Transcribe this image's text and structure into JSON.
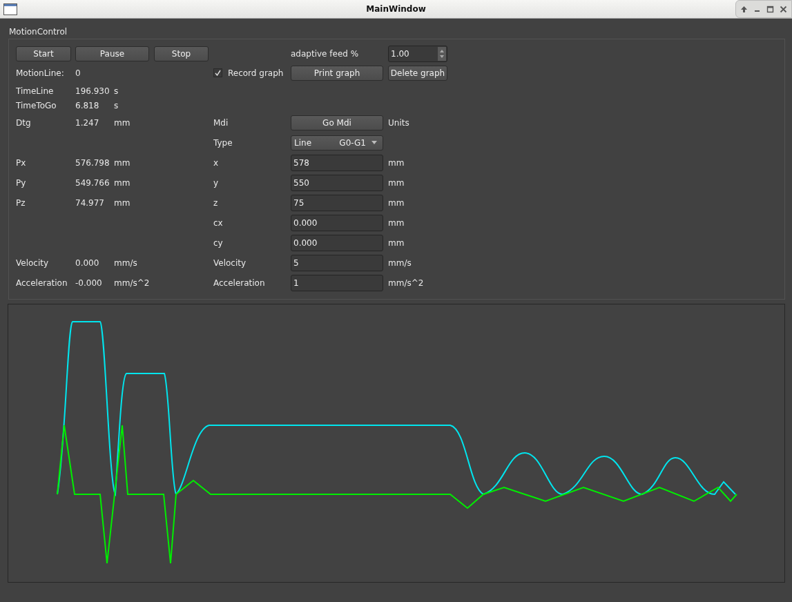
{
  "window": {
    "title": "MainWindow"
  },
  "group_title": "MotionControl",
  "motion_buttons": [
    "Start",
    "Pause",
    "Stop"
  ],
  "adaptive_feed": {
    "label": "adaptive feed %",
    "value": "1.00"
  },
  "motion_line": {
    "label": "MotionLine:",
    "value": "0"
  },
  "record_graph": {
    "label": "Record graph",
    "checked": true
  },
  "graph_buttons": [
    "Print graph",
    "Delete graph"
  ],
  "timing": [
    {
      "label": "TimeLine",
      "value": "196.930",
      "unit": "s"
    },
    {
      "label": "TimeToGo",
      "value": "6.818",
      "unit": "s"
    },
    {
      "label": "Dtg",
      "value": "1.247",
      "unit": "mm"
    }
  ],
  "position": [
    {
      "label": "Px",
      "value": "576.798",
      "unit": "mm"
    },
    {
      "label": "Py",
      "value": "549.766",
      "unit": "mm"
    },
    {
      "label": "Pz",
      "value": "74.977",
      "unit": "mm"
    }
  ],
  "motion": [
    {
      "label": "Velocity",
      "value": "0.000",
      "unit": "mm/s"
    },
    {
      "label": "Acceleration",
      "value": "-0.000",
      "unit": "mm/s^2"
    }
  ],
  "mdi": {
    "label": "Mdi",
    "button": "Go Mdi",
    "units_label": "Units",
    "type_label": "Type",
    "type_value": "Line",
    "type_code": "G0-G1",
    "fields": [
      {
        "label": "x",
        "value": "578",
        "unit": "mm"
      },
      {
        "label": "y",
        "value": "550",
        "unit": "mm"
      },
      {
        "label": "z",
        "value": "75",
        "unit": "mm"
      },
      {
        "label": "cx",
        "value": "0.000",
        "unit": "mm"
      },
      {
        "label": "cy",
        "value": "0.000",
        "unit": "mm"
      },
      {
        "label": "Velocity",
        "value": "5",
        "unit": "mm/s"
      },
      {
        "label": "Acceleration",
        "value": "1",
        "unit": "mm/s^2"
      }
    ]
  }
}
